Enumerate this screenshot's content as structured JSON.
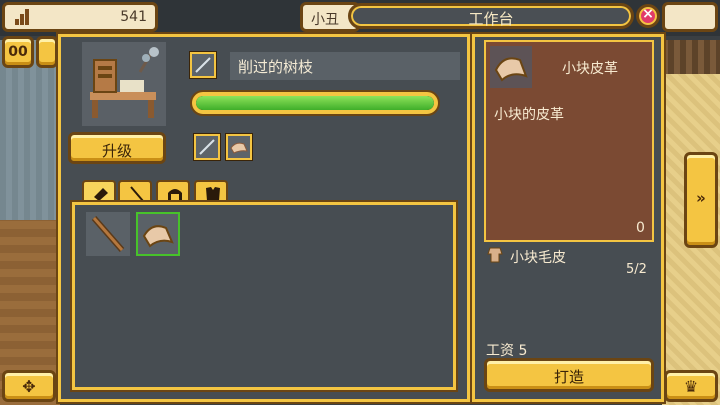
{
  "hud": {
    "resource_value": "541",
    "character_name": "小丑",
    "pause_label": "00",
    "right_arrow_label": "»"
  },
  "dialog": {
    "title": "工作台",
    "close_label": "×",
    "upgrade_label": "升级",
    "selected_item_name": "削过的树枝",
    "progress": 1.0,
    "tabs": [
      "resources",
      "tools",
      "helmets",
      "armor"
    ],
    "grid_items": [
      "wooden-stick",
      "leather-scrap"
    ],
    "selected_grid_index": 1
  },
  "detail": {
    "title": "小块皮革",
    "description": "小块的皮革",
    "owned_count": "0",
    "requirement_name": "小块毛皮",
    "requirement_amount": "5/2",
    "wage": "工资 5",
    "craft_label": "打造"
  },
  "colors": {
    "gold": "#f4c542",
    "border_brown": "#6b4513",
    "panel_gray": "#474d52",
    "progress_green": "#47c22a",
    "close_pink": "#e13b6a",
    "detail_brown": "#7b4a33"
  }
}
